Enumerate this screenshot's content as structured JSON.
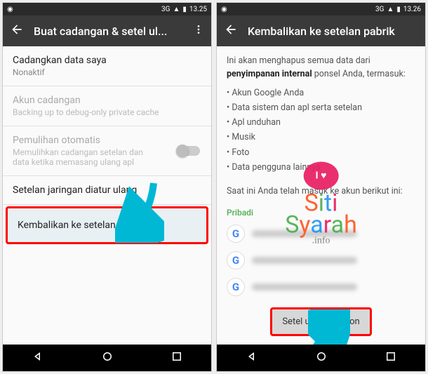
{
  "status": {
    "time_left": "13.25",
    "time_right": "13.26",
    "net": "3G"
  },
  "left": {
    "title": "Buat cadangan & setel ul...",
    "backup_data": {
      "title": "Cadangkan data saya",
      "subtitle": "Nonaktif"
    },
    "backup_account": {
      "title": "Akun cadangan",
      "subtitle": "Backing up to debug-only private cache"
    },
    "auto_restore": {
      "title": "Pemulihan otomatis",
      "subtitle": "Memulihkan cadangan setelan dan data ketika memasang ulang apl"
    },
    "network_reset": {
      "title": "Setelan jaringan diatur ulang"
    },
    "factory_reset": {
      "title": "Kembalikan ke setelan pabrik"
    }
  },
  "right": {
    "title": "Kembalikan ke setelan pabrik",
    "intro_pre": "Ini akan menghapus semua data dari ",
    "intro_bold": "penyimpanan internal",
    "intro_post": " ponsel Anda, termasuk:",
    "bullets": [
      "Akun Google Anda",
      "Data sistem dan apl serta setelan",
      "Apl unduhan",
      "Musik",
      "Foto",
      "Data pengguna lainnya"
    ],
    "signed_in": "Saat ini Anda telah masuk ke akun berikut ini:",
    "section": "Pribadi",
    "reset_button": "Setel ulang telepon"
  },
  "watermark": {
    "bubble": "I ♥",
    "line1": "Siti",
    "line2": "Syarah",
    "info": ".info"
  }
}
